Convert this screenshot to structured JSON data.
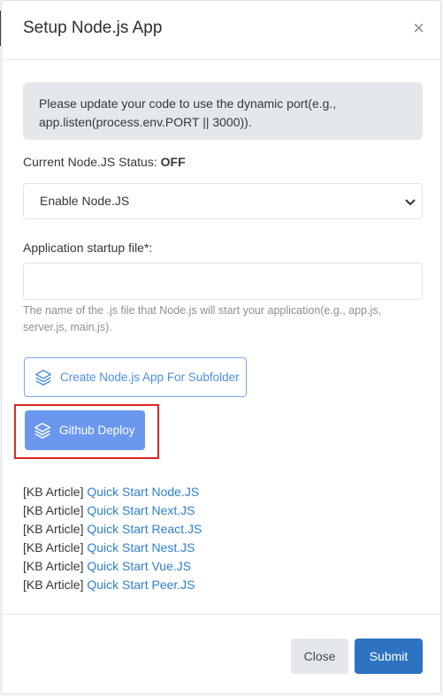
{
  "modal": {
    "title": "Setup Node.js App",
    "close_symbol": "×"
  },
  "alert": {
    "text": "Please update your code to use the dynamic port(e.g., app.listen(process.env.PORT || 3000))."
  },
  "status": {
    "label": "Current Node.JS Status:",
    "value": "OFF"
  },
  "select": {
    "selected": "Enable Node.JS"
  },
  "startup": {
    "label": "Application startup file*:",
    "value": "",
    "help": "The name of the .js file that Node.js will start your application(e.g., app.js, server.js, main.js)."
  },
  "buttons": {
    "subfolder": "Create Node.js App For Subfolder",
    "github": "Github Deploy",
    "close": "Close",
    "submit": "Submit"
  },
  "kb": {
    "prefix": "[KB Article]",
    "links": [
      "Quick Start Node.JS",
      "Quick Start Next.JS",
      "Quick Start React.JS",
      "Quick Start Nest.JS",
      "Quick Start Vue.JS",
      "Quick Start Peer.JS"
    ]
  },
  "icons": {
    "layers": "layers-icon",
    "close": "close-icon",
    "dropdown": "chevron-down-icon"
  },
  "colors": {
    "primary": "#2d73c2",
    "github_button": "#6b98ee",
    "link": "#2f7fd1",
    "highlight_border": "#e02424"
  }
}
